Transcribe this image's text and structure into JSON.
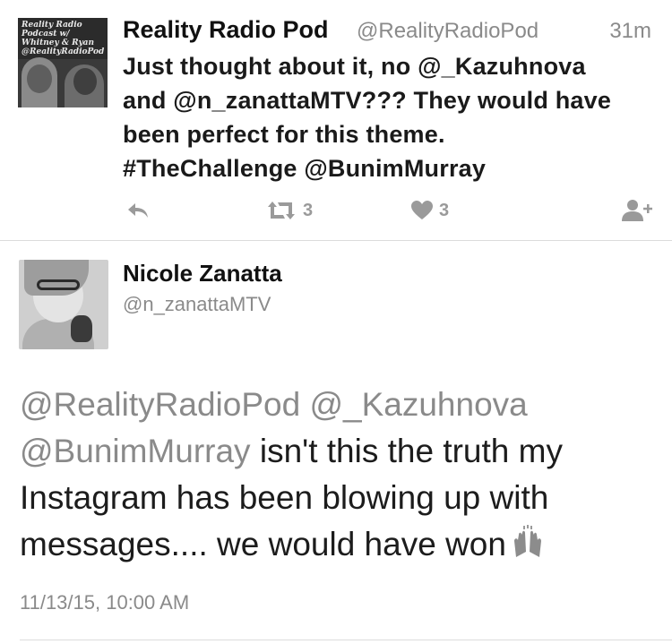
{
  "tweet1": {
    "avatar_text": "Reality Radio Podcast w/ Whitney & Ryan @RealityRadioPod",
    "name": "Reality Radio Pod",
    "handle": "@RealityRadioPod",
    "time": "31m",
    "body_lines": [
      "Just thought about it, no @_Kazuhnova",
      "and @n_zanattaMTV??? They would have",
      "been perfect for this theme.",
      "#TheChallenge @BunimMurray"
    ],
    "retweet_count": "3",
    "like_count": "3",
    "icons": {
      "reply": "reply-icon",
      "retweet": "retweet-icon",
      "like": "heart-icon",
      "follow": "add-user-icon"
    }
  },
  "tweet2": {
    "name": "Nicole Zanatta",
    "handle": "@n_zanattaMTV",
    "mention1": "@RealityRadioPod",
    "mention2": "@_Kazuhnova",
    "mention3": "@BunimMurray",
    "line2_rest": " isn't this the truth my",
    "line3": "Instagram has been blowing up with",
    "line4": "messages.... we would have won",
    "emoji_icon": "raised-hands-icon",
    "date": "11/13/15, 10:00 AM"
  },
  "colors": {
    "text": "#1a1a1a",
    "secondary": "#8a8a8a",
    "icon": "#9a9a9a",
    "divider": "#dcdcdc"
  }
}
